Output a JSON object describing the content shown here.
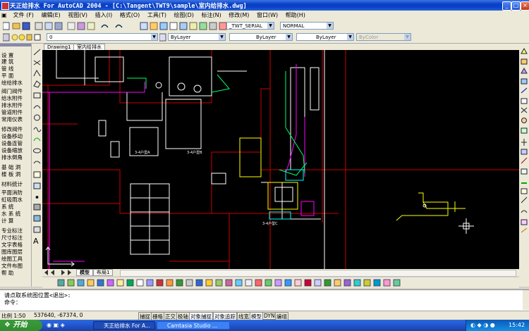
{
  "window": {
    "title": "天正给排水 For AutoCAD 2004 - [C:\\Tangent\\TWT9\\sample\\室内给排水.dwg]",
    "min_glyph": "_",
    "max_glyph": "□",
    "close_glyph": "×"
  },
  "menu": [
    {
      "label": "文件 (F)"
    },
    {
      "label": "编辑(E)"
    },
    {
      "label": "视图(V)"
    },
    {
      "label": "插入(I)"
    },
    {
      "label": "格式(O)"
    },
    {
      "label": "工具(T)"
    },
    {
      "label": "绘图(D)"
    },
    {
      "label": "标注(N)"
    },
    {
      "label": "修改(M)"
    },
    {
      "label": "窗口(W)"
    },
    {
      "label": "帮助(H)"
    }
  ],
  "toolbar": {
    "text_style": "_TWT_SERIAL",
    "dim_style": "NORMAL",
    "layer": "0",
    "color": "ByLayer",
    "linetype": "ByLayer",
    "lineweight": "ByLayer",
    "plotstyle": "ByColor"
  },
  "drawing_tabs": [
    {
      "label": "Drawing1"
    },
    {
      "label": "室内给排水"
    }
  ],
  "left_panel": [
    {
      "label": "设    置"
    },
    {
      "label": "建    筑"
    },
    {
      "label": "管    线"
    },
    {
      "label": "平    面"
    },
    {
      "label": "绘给排水"
    },
    {
      "label": "阀门阀件"
    },
    {
      "label": "给水附件"
    },
    {
      "label": "排水附件"
    },
    {
      "label": "管道附件"
    },
    {
      "label": "常用仪表"
    },
    {
      "label": "修改阀件"
    },
    {
      "label": "设备移动"
    },
    {
      "label": "设备连管"
    },
    {
      "label": "设备缩放"
    },
    {
      "label": "排水倒角"
    },
    {
      "label": "基 础 洞"
    },
    {
      "label": "楼 板 洞"
    },
    {
      "label": "材料统计"
    },
    {
      "label": "平面消防"
    },
    {
      "label": "虹吸雨水"
    },
    {
      "label": "系    统"
    },
    {
      "label": "水 系 统"
    },
    {
      "label": "计    算"
    },
    {
      "label": "专业标注"
    },
    {
      "label": "尺寸标注"
    },
    {
      "label": "文字表格"
    },
    {
      "label": "图库图层"
    },
    {
      "label": "绘图工具"
    },
    {
      "label": "文件布图"
    },
    {
      "label": "帮    助"
    }
  ],
  "layout_tabs": [
    {
      "label": "模型"
    },
    {
      "label": "布局1"
    }
  ],
  "command_lines": [
    "请点取系统图位置<退出>:",
    "命令："
  ],
  "status": {
    "scale": "比例 1:50",
    "coords": "537640, -67374, 0",
    "buttons": [
      {
        "label": "捕捉",
        "on": false
      },
      {
        "label": "栅格",
        "on": false
      },
      {
        "label": "正交",
        "on": false
      },
      {
        "label": "极轴",
        "on": false
      },
      {
        "label": "对象捕捉",
        "on": true
      },
      {
        "label": "对象追踪",
        "on": true
      },
      {
        "label": "线宽",
        "on": false
      },
      {
        "label": "模型",
        "on": true
      },
      {
        "label": "DYN",
        "on": false
      },
      {
        "label": "编组",
        "on": false
      }
    ]
  },
  "taskbar": {
    "start": "开始",
    "tasks": [
      {
        "label": "天正给排水 For A..."
      },
      {
        "label": "Camtasia Studio ..."
      }
    ],
    "clock": "15:42"
  },
  "colors": {
    "canvas": "#000000",
    "title_blue": "#0a43c8",
    "wall_red": "#cc0000",
    "pipe_green": "#00ff66",
    "pipe_magenta": "#ff00ff",
    "cad_yellow": "#ffff00",
    "cad_cyan": "#00ffff"
  },
  "canvas_labels": [
    "3-4户型A",
    "3-4户型B",
    "3-4户型C"
  ]
}
